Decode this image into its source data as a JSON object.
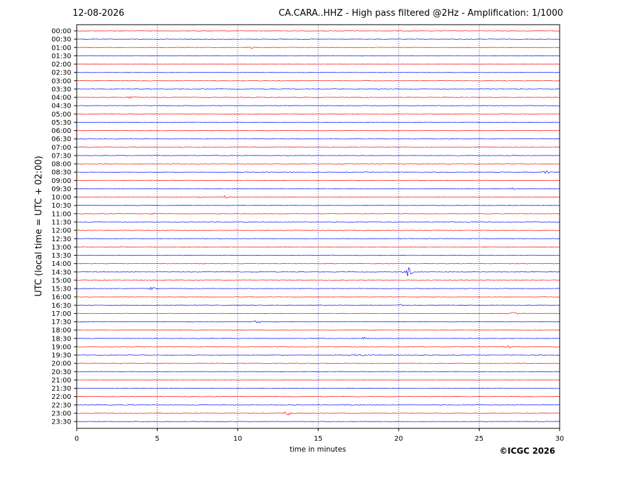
{
  "header": {
    "date": "12-08-2026",
    "title": "CA.CARA..HHZ - High pass filtered @2Hz - Amplification: 1/1000"
  },
  "footer": {
    "copyright": "©ICGC 2026"
  },
  "chart_data": {
    "type": "line",
    "title": "CA.CARA..HHZ - High pass filtered @2Hz - Amplification: 1/1000",
    "xlabel": "time in minutes",
    "ylabel": "UTC (local time = UTC + 02:00)",
    "xlim": [
      0,
      30
    ],
    "x_ticks": [
      0,
      5,
      10,
      15,
      20,
      25,
      30
    ],
    "grid": "vertical dotted at each x tick",
    "series_colors": [
      "#ff0000",
      "#0000ff"
    ],
    "rows": [
      "00:00",
      "00:30",
      "01:00",
      "01:30",
      "02:00",
      "02:30",
      "03:00",
      "03:30",
      "04:00",
      "04:30",
      "05:00",
      "05:30",
      "06:00",
      "06:30",
      "07:00",
      "07:30",
      "08:00",
      "08:30",
      "09:00",
      "09:30",
      "10:00",
      "10:30",
      "11:00",
      "11:30",
      "12:00",
      "12:30",
      "13:00",
      "13:30",
      "14:00",
      "14:30",
      "15:00",
      "15:30",
      "16:00",
      "16:30",
      "17:00",
      "17:30",
      "18:00",
      "18:30",
      "19:00",
      "19:30",
      "20:00",
      "20:30",
      "21:00",
      "21:30",
      "22:00",
      "22:30",
      "23:00",
      "23:30"
    ],
    "events": [
      {
        "row": "01:00",
        "minute": 10.8,
        "amplitude": 1.5
      },
      {
        "row": "04:00",
        "minute": 3.4,
        "amplitude": 1.5
      },
      {
        "row": "08:30",
        "minute": 29.2,
        "amplitude": 2
      },
      {
        "row": "09:30",
        "minute": 27,
        "amplitude": 1.5
      },
      {
        "row": "10:00",
        "minute": 9.3,
        "amplitude": 3
      },
      {
        "row": "10:00",
        "minute": 7.5,
        "amplitude": 1.5
      },
      {
        "row": "11:00",
        "minute": 4.7,
        "amplitude": 1.5
      },
      {
        "row": "14:30",
        "minute": 20.6,
        "amplitude": 6
      },
      {
        "row": "15:30",
        "minute": 4.8,
        "amplitude": 4
      },
      {
        "row": "16:30",
        "minute": 20.2,
        "amplitude": 1.5
      },
      {
        "row": "17:00",
        "minute": 27.2,
        "amplitude": 1.5
      },
      {
        "row": "17:30",
        "minute": 11.2,
        "amplitude": 2
      },
      {
        "row": "18:30",
        "minute": 17.9,
        "amplitude": 1.5
      },
      {
        "row": "19:00",
        "minute": 26.8,
        "amplitude": 1.5
      },
      {
        "row": "19:30",
        "minute": 17.8,
        "amplitude": 1.5
      },
      {
        "row": "23:00",
        "minute": 13.1,
        "amplitude": 3
      }
    ]
  }
}
